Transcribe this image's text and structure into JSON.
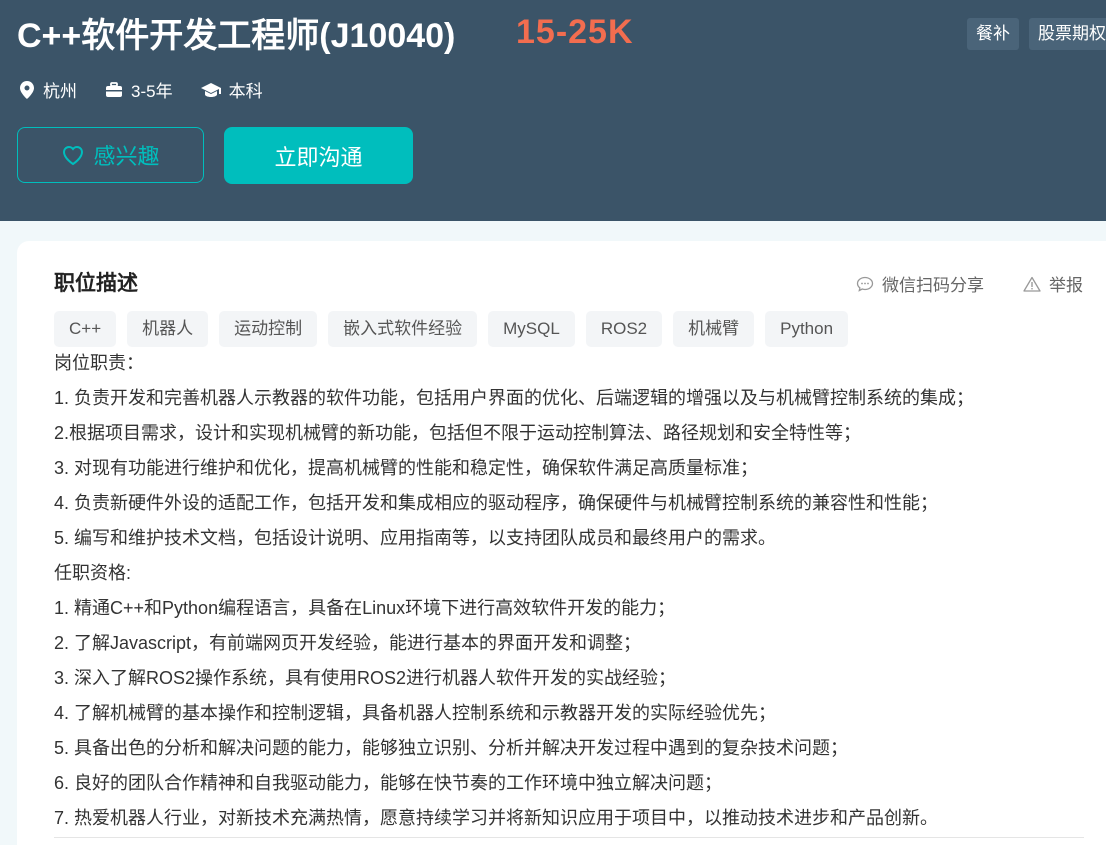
{
  "header": {
    "title": "C++软件开发工程师(J10040)",
    "salary": "15-25K",
    "benefits": [
      "餐补",
      "股票期权"
    ],
    "meta": {
      "city": "杭州",
      "experience": "3-5年",
      "degree": "本科"
    },
    "interest_label": "感兴趣",
    "chat_label": "立即沟通"
  },
  "job": {
    "section_title": "职位描述",
    "share_label": "微信扫码分享",
    "report_label": "举报",
    "tags": [
      "C++",
      "机器人",
      "运动控制",
      "嵌入式软件经验",
      "MySQL",
      "ROS2",
      "机械臂",
      "Python"
    ],
    "lines": [
      "岗位职责：",
      "1. 负责开发和完善机器人示教器的软件功能，包括用户界面的优化、后端逻辑的增强以及与机械臂控制系统的集成；",
      "2.根据项目需求，设计和实现机械臂的新功能，包括但不限于运动控制算法、路径规划和安全特性等；",
      "3. 对现有功能进行维护和优化，提高机械臂的性能和稳定性，确保软件满足高质量标准；",
      "4. 负责新硬件外设的适配工作，包括开发和集成相应的驱动程序，确保硬件与机械臂控制系统的兼容性和性能；",
      "5. 编写和维护技术文档，包括设计说明、应用指南等，以支持团队成员和最终用户的需求。",
      "任职资格:",
      "1. 精通C++和Python编程语言，具备在Linux环境下进行高效软件开发的能力；",
      "2. 了解Javascript，有前端网页开发经验，能进行基本的界面开发和调整；",
      "3. 深入了解ROS2操作系统，具有使用ROS2进行机器人软件开发的实战经验；",
      "4. 了解机械臂的基本操作和控制逻辑，具备机器人控制系统和示教器开发的实际经验优先；",
      "5. 具备出色的分析和解决问题的能力，能够独立识别、分析并解决开发过程中遇到的复杂技术问题；",
      "6. 良好的团队合作精神和自我驱动能力，能够在快节奏的工作环境中独立解决问题；",
      "7. 热爱机器人行业，对新技术充满热情，愿意持续学习并将新知识应用于项目中，以推动技术进步和产品创新。"
    ]
  },
  "colors": {
    "header_bg": "#3b5468",
    "accent": "#00bebd",
    "salary": "#f26d4f"
  }
}
